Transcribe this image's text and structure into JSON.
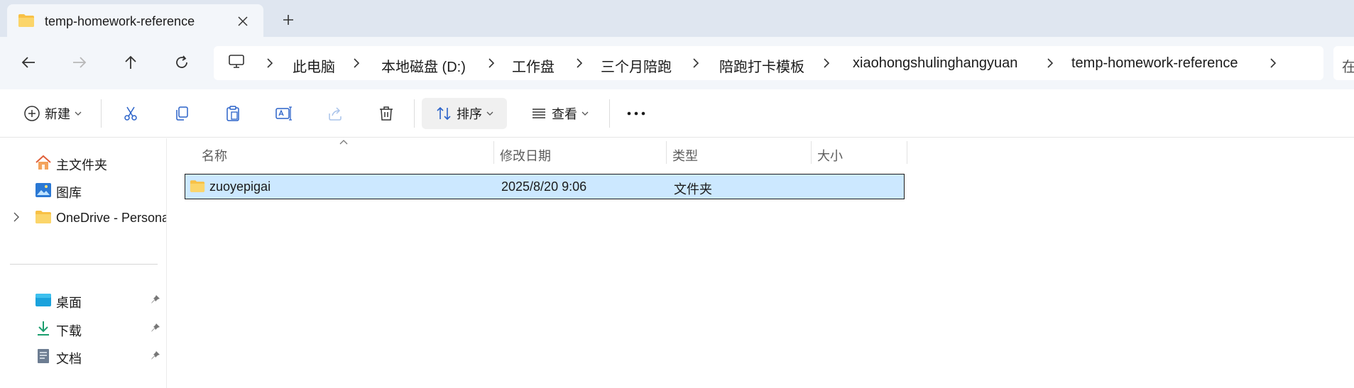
{
  "tab": {
    "title": "temp-homework-reference",
    "close_icon": "×",
    "new_tab_icon": "+"
  },
  "breadcrumb": {
    "items": [
      "此电脑",
      "本地磁盘 (D:)",
      "工作盘",
      "三个月陪跑",
      "陪跑打卡模板",
      "xiaohongshulinghangyuan",
      "temp-homework-reference"
    ],
    "search_partial": "在"
  },
  "toolbar": {
    "new_label": "新建",
    "sort_label": "排序",
    "view_label": "查看",
    "more_icon": "···"
  },
  "sidebar": {
    "items": [
      {
        "label": "主文件夹",
        "icon": "home-icon"
      },
      {
        "label": "图库",
        "icon": "gallery-icon"
      },
      {
        "label": "OneDrive - Personal",
        "icon": "folder-icon"
      },
      {
        "label": "桌面",
        "icon": "desktop-icon"
      },
      {
        "label": "下载",
        "icon": "download-icon"
      },
      {
        "label": "文档",
        "icon": "document-icon"
      }
    ]
  },
  "columns": {
    "name": "名称",
    "modified": "修改日期",
    "type": "类型",
    "size": "大小"
  },
  "files": [
    {
      "name": "zuoyepigai",
      "modified": "2025/8/20 9:06",
      "type": "文件夹",
      "size": ""
    }
  ],
  "colors": {
    "tabbar_bg": "#dfe6f0",
    "selection": "#cce8ff",
    "folder_yellow": "#f8c146"
  }
}
